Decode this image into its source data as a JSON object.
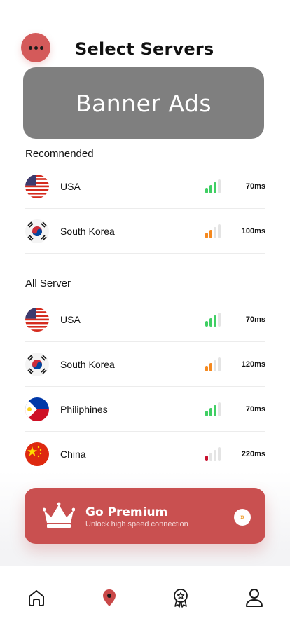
{
  "header": {
    "title": "Select Servers",
    "menu_icon": "more-dots-icon"
  },
  "banner": {
    "label": "Banner Ads"
  },
  "recommended": {
    "title": "Recomnended",
    "servers": [
      {
        "country": "USA",
        "flag": "usa-flag-icon",
        "ping": "70ms",
        "signal_level": 3,
        "signal_color": "#3fcf63"
      },
      {
        "country": "South Korea",
        "flag": "south-korea-flag-icon",
        "ping": "100ms",
        "signal_level": 2,
        "signal_color": "#f5891f"
      }
    ]
  },
  "all_servers": {
    "title": "All Server",
    "servers": [
      {
        "country": "USA",
        "flag": "usa-flag-icon",
        "ping": "70ms",
        "signal_level": 3,
        "signal_color": "#3fcf63"
      },
      {
        "country": "South Korea",
        "flag": "south-korea-flag-icon",
        "ping": "120ms",
        "signal_level": 2,
        "signal_color": "#f5891f"
      },
      {
        "country": "Philiphines",
        "flag": "philippines-flag-icon",
        "ping": "70ms",
        "signal_level": 3,
        "signal_color": "#3fcf63"
      },
      {
        "country": "China",
        "flag": "china-flag-icon",
        "ping": "220ms",
        "signal_level": 1,
        "signal_color": "#c8102e"
      }
    ]
  },
  "premium": {
    "title": "Go Premium",
    "subtitle": "Unlock high speed connection",
    "button_label": "»",
    "icon": "crown-icon"
  },
  "tabbar": {
    "items": [
      {
        "name": "home",
        "icon": "home-icon"
      },
      {
        "name": "location",
        "icon": "location-pin-icon",
        "active": true
      },
      {
        "name": "premium",
        "icon": "award-badge-icon"
      },
      {
        "name": "profile",
        "icon": "user-icon"
      }
    ]
  },
  "colors": {
    "accent": "#c95050",
    "menu_button": "#d45a5a",
    "banner": "#7f7f7f",
    "signal_good": "#3fcf63",
    "signal_medium": "#f5891f",
    "signal_weak": "#c8102e",
    "signal_inactive": "#e4e4e4"
  }
}
